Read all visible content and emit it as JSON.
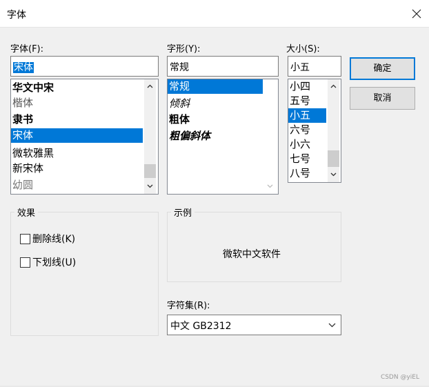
{
  "window": {
    "title": "字体",
    "close_icon": "close-icon"
  },
  "font": {
    "label": "字体(F):",
    "value": "宋体",
    "items": [
      "华文中宋",
      "楷体",
      "隶书",
      "宋体",
      "微软雅黑",
      "新宋体",
      "幼圆"
    ],
    "selected": "宋体"
  },
  "style": {
    "label": "字形(Y):",
    "value": "常规",
    "items": [
      "常规",
      "倾斜",
      "粗体",
      "粗偏斜体"
    ],
    "selected": "常规"
  },
  "size": {
    "label": "大小(S):",
    "value": "小五",
    "items": [
      "小四",
      "五号",
      "小五",
      "六号",
      "小六",
      "七号",
      "八号"
    ],
    "selected": "小五"
  },
  "buttons": {
    "ok": "确定",
    "cancel": "取消"
  },
  "effects": {
    "title": "效果",
    "strikeout": {
      "label": "删除线(K)",
      "checked": false
    },
    "underline": {
      "label": "下划线(U)",
      "checked": false
    }
  },
  "sample": {
    "title": "示例",
    "text": "微软中文软件"
  },
  "charset": {
    "label": "字符集(R):",
    "value": "中文 GB2312"
  },
  "watermark": "CSDN @yiEL"
}
